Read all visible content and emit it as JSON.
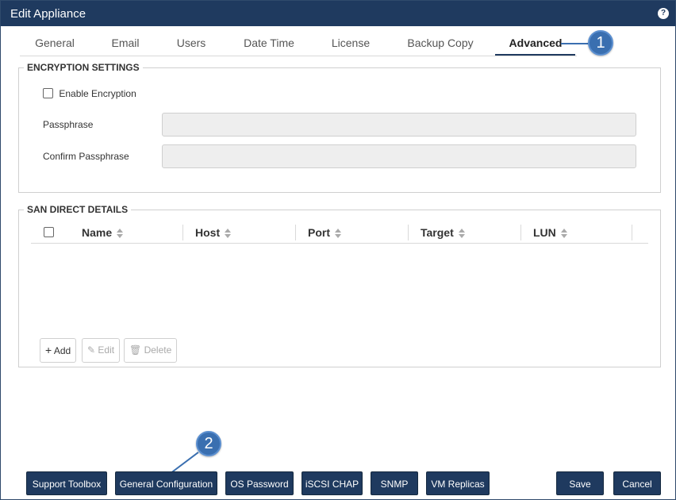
{
  "window": {
    "title": "Edit Appliance",
    "help_label": "?"
  },
  "tabs": [
    {
      "label": "General"
    },
    {
      "label": "Email"
    },
    {
      "label": "Users"
    },
    {
      "label": "Date Time"
    },
    {
      "label": "License"
    },
    {
      "label": "Backup Copy"
    },
    {
      "label": "Advanced",
      "active": true
    }
  ],
  "callouts": {
    "one": "1",
    "two": "2"
  },
  "encryption": {
    "legend": "ENCRYPTION SETTINGS",
    "enable_label": "Enable Encryption",
    "enabled": false,
    "passphrase_label": "Passphrase",
    "passphrase_value": "",
    "confirm_label": "Confirm Passphrase",
    "confirm_value": ""
  },
  "san": {
    "legend": "SAN DIRECT DETAILS",
    "columns": [
      "Name",
      "Host",
      "Port",
      "Target",
      "LUN"
    ],
    "rows": [],
    "add_label": "Add",
    "edit_label": "Edit",
    "delete_label": "Delete"
  },
  "footer": {
    "support_toolbox": "Support Toolbox",
    "general_configuration": "General Configuration",
    "os_password": "OS Password",
    "iscsi_chap": "iSCSI CHAP",
    "snmp": "SNMP",
    "vm_replicas": "VM Replicas",
    "save": "Save",
    "cancel": "Cancel"
  },
  "colors": {
    "primary": "#1f3a5f",
    "callout": "#3a6fb0"
  }
}
